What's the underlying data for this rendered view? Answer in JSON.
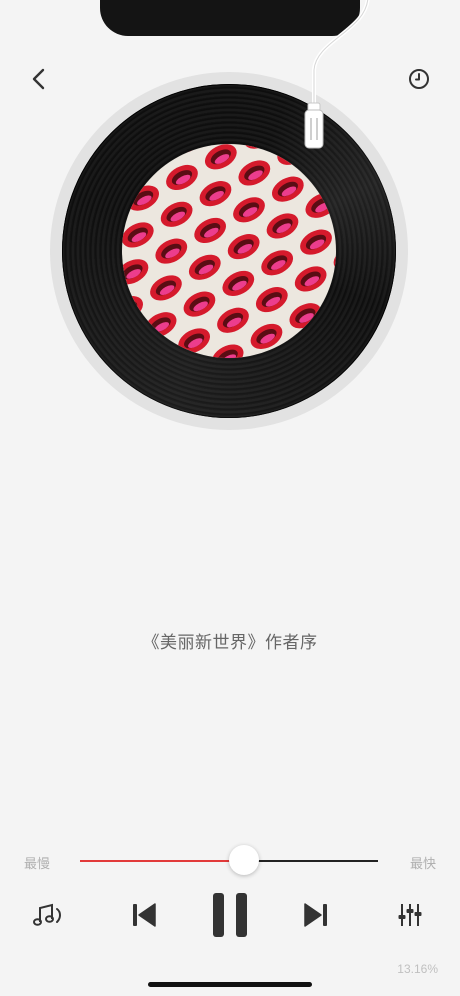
{
  "header": {
    "back_icon": "chevron-left-icon",
    "history_icon": "clock-icon"
  },
  "player": {
    "track_title": "《美丽新世界》作者序",
    "cover_icon": "album-cover-red-lips"
  },
  "speed": {
    "slow_label": "最慢",
    "fast_label": "最快",
    "level": 0.55,
    "accent_color": "#e23a3a"
  },
  "controls": {
    "playlist_icon": "music-notes-icon",
    "previous_icon": "skip-previous-icon",
    "pause_icon": "pause-icon",
    "next_icon": "skip-next-icon",
    "settings_icon": "equalizer-sliders-icon"
  },
  "progress": {
    "percent_text": "13.16%"
  }
}
